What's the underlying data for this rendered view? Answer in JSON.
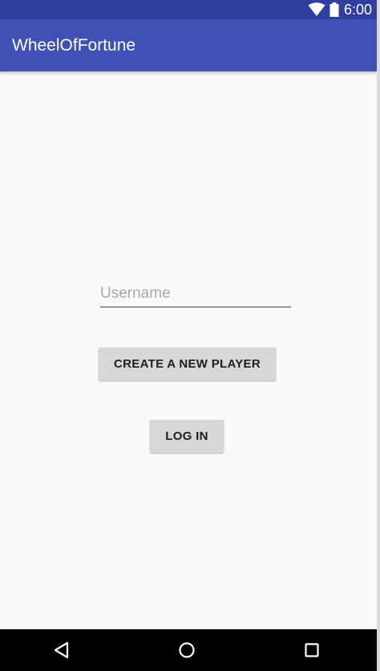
{
  "status_bar": {
    "time": "6:00",
    "icons": [
      "wifi-icon",
      "battery-icon"
    ]
  },
  "app_bar": {
    "title": "WheelOfFortune"
  },
  "form": {
    "username_placeholder": "Username",
    "username_value": "",
    "create_button_label": "CREATE A NEW PLAYER",
    "login_button_label": "LOG IN"
  },
  "nav_bar": {
    "buttons": [
      "back-icon",
      "home-icon",
      "recents-icon"
    ]
  },
  "colors": {
    "status_bar": "#303f9f",
    "app_bar": "#3f51b5",
    "background": "#fafafa",
    "button": "#d6d7d7",
    "nav_bar": "#000000"
  }
}
